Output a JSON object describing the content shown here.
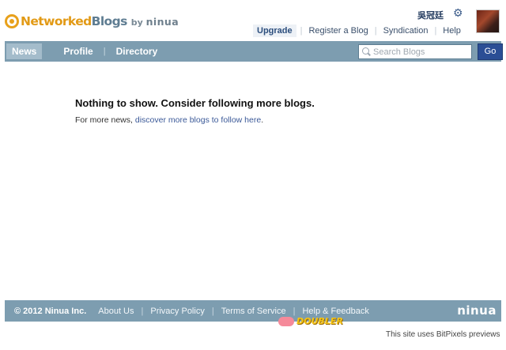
{
  "header": {
    "logo_part1": "Networked",
    "logo_part2": "Blogs",
    "logo_by": "by",
    "logo_ninua": "ninua",
    "username": "吳冠廷",
    "links": {
      "upgrade": "Upgrade",
      "register": "Register a Blog",
      "syndication": "Syndication",
      "help": "Help"
    }
  },
  "nav": {
    "news": "News",
    "profile": "Profile",
    "directory": "Directory",
    "search_placeholder": "Search Blogs",
    "go_label": "Go"
  },
  "main": {
    "title": "Nothing to show. Consider following more blogs.",
    "sub_prefix": "For more news, ",
    "sub_link": "discover more blogs to follow here",
    "sub_suffix": "."
  },
  "footer": {
    "copyright": "© 2012 Ninua Inc.",
    "about": "About Us",
    "privacy": "Privacy Policy",
    "terms": "Terms of Service",
    "help_feedback": "Help & Feedback",
    "logo": "ninua"
  },
  "overlay": {
    "doubler": "DOUBLER",
    "bitpixels": "This site uses BitPixels previews"
  },
  "colors": {
    "bar": "#7d9db0",
    "go_button": "#2b4e95",
    "logo_orange": "#e29a16",
    "link": "#3b5998"
  }
}
